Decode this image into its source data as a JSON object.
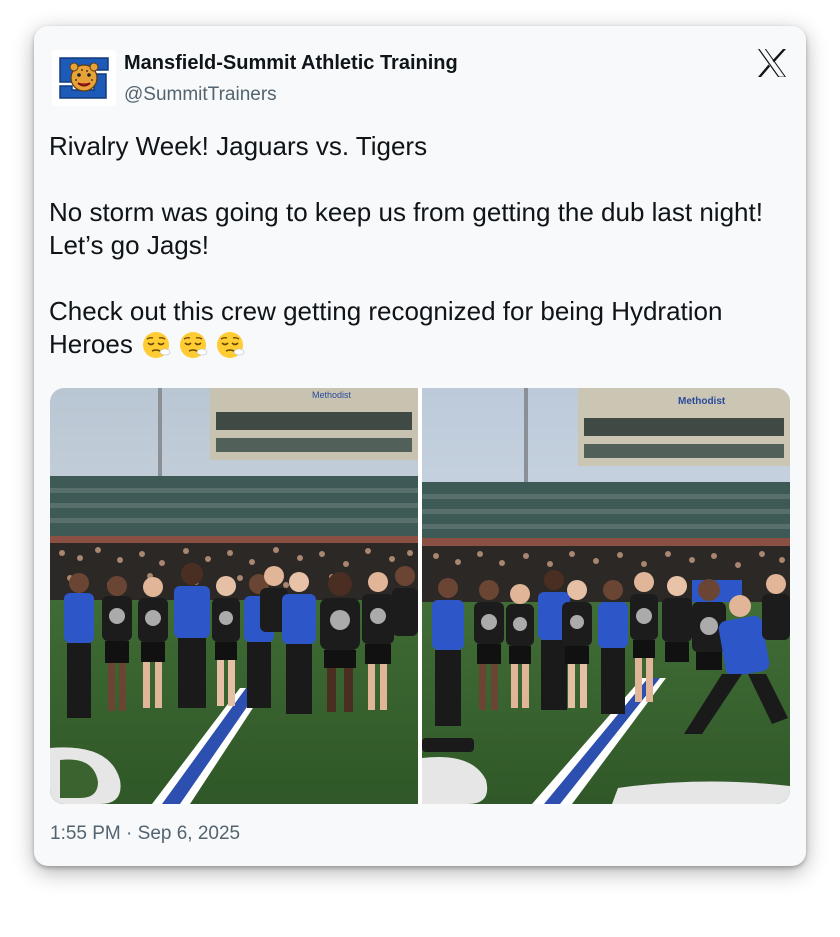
{
  "tweet": {
    "author_name": "Mansfield-Summit Athletic Training",
    "author_handle": "@SummitTrainers",
    "text": "Rivalry Week! Jaguars vs. Tigers\n\nNo storm was going to keep us from getting the dub last night! Let’s go Jags!\n\nCheck out this crew getting recognized for being Hydration Heroes ",
    "emojis": [
      "relieved-face-emoji",
      "relieved-face-emoji",
      "relieved-face-emoji"
    ],
    "timestamp": "1:55 PM · Sep 6, 2025"
  },
  "photos": {
    "left": {
      "sponsor_sign": "Methodist"
    },
    "right": {
      "sponsor_sign": "Methodist"
    }
  },
  "colors": {
    "text": "#0f1419",
    "secondary": "#536471",
    "card_bg": "#f7f9fa",
    "team_blue": "#2d56c8"
  },
  "icons": {
    "logo": "x-logo-icon",
    "avatar": "jaguar-logo-avatar"
  }
}
